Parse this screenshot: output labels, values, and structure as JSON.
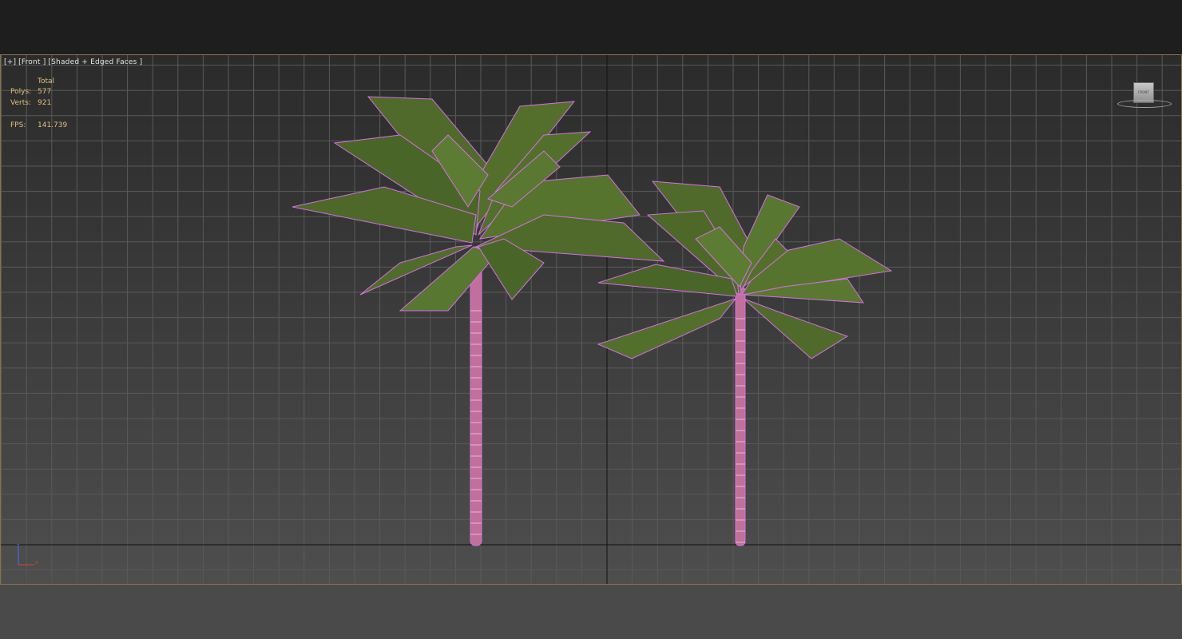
{
  "viewport": {
    "label_parts": [
      "[+]",
      "[Front ]",
      "[Shaded + Edged Faces ]"
    ],
    "stats": {
      "header": "Total",
      "polys_label": "Polys:",
      "polys_value": "577",
      "verts_label": "Verts:",
      "verts_value": "921",
      "fps_label": "FPS:",
      "fps_value": "141.739"
    },
    "viewcube_label": "FRONT",
    "axis_labels": {
      "x": "x",
      "z": "z"
    }
  },
  "colors": {
    "wireframe": "#d86fe6",
    "leaf": "#4f6a2a",
    "trunk": "#c0709a",
    "grid": "#5a5a5a",
    "stats_text": "#e0c07a",
    "viewport_border": "#8a7246"
  }
}
